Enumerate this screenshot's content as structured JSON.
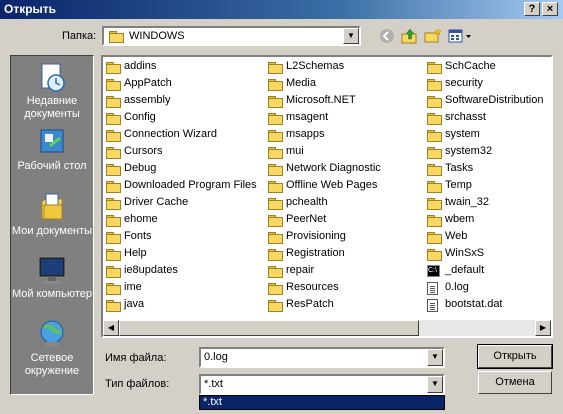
{
  "window": {
    "title": "Открыть",
    "help_glyph": "?",
    "close_glyph": "×"
  },
  "toolbar": {
    "folder_label": "Папка:",
    "current_folder": "WINDOWS",
    "icons": [
      "back-icon",
      "up-folder-icon",
      "new-folder-icon",
      "views-menu-icon"
    ]
  },
  "places": [
    {
      "label": "Недавние документы",
      "icon": "recent-documents-icon"
    },
    {
      "label": "Рабочий стол",
      "icon": "desktop-icon"
    },
    {
      "label": "Мои документы",
      "icon": "my-documents-icon"
    },
    {
      "label": "Мой компьютер",
      "icon": "my-computer-icon"
    },
    {
      "label": "Сетевое окружение",
      "icon": "network-places-icon"
    }
  ],
  "files": [
    {
      "name": "addins",
      "type": "folder"
    },
    {
      "name": "AppPatch",
      "type": "folder"
    },
    {
      "name": "assembly",
      "type": "folder"
    },
    {
      "name": "Config",
      "type": "folder"
    },
    {
      "name": "Connection Wizard",
      "type": "folder"
    },
    {
      "name": "Cursors",
      "type": "folder"
    },
    {
      "name": "Debug",
      "type": "folder"
    },
    {
      "name": "Downloaded Program Files",
      "type": "special-folder"
    },
    {
      "name": "Driver Cache",
      "type": "folder"
    },
    {
      "name": "ehome",
      "type": "folder"
    },
    {
      "name": "Fonts",
      "type": "folder"
    },
    {
      "name": "Help",
      "type": "folder"
    },
    {
      "name": "ie8updates",
      "type": "folder"
    },
    {
      "name": "ime",
      "type": "folder"
    },
    {
      "name": "java",
      "type": "folder"
    },
    {
      "name": "L2Schemas",
      "type": "folder"
    },
    {
      "name": "Media",
      "type": "folder"
    },
    {
      "name": "Microsoft.NET",
      "type": "folder"
    },
    {
      "name": "msagent",
      "type": "folder"
    },
    {
      "name": "msapps",
      "type": "folder"
    },
    {
      "name": "mui",
      "type": "folder"
    },
    {
      "name": "Network Diagnostic",
      "type": "folder"
    },
    {
      "name": "Offline Web Pages",
      "type": "special-folder"
    },
    {
      "name": "pchealth",
      "type": "folder"
    },
    {
      "name": "PeerNet",
      "type": "folder"
    },
    {
      "name": "Provisioning",
      "type": "folder"
    },
    {
      "name": "Registration",
      "type": "folder"
    },
    {
      "name": "repair",
      "type": "folder"
    },
    {
      "name": "Resources",
      "type": "folder"
    },
    {
      "name": "ResPatch",
      "type": "folder"
    },
    {
      "name": "SchCache",
      "type": "folder"
    },
    {
      "name": "security",
      "type": "folder"
    },
    {
      "name": "SoftwareDistribution",
      "type": "folder"
    },
    {
      "name": "srchasst",
      "type": "folder"
    },
    {
      "name": "system",
      "type": "folder"
    },
    {
      "name": "system32",
      "type": "folder"
    },
    {
      "name": "Tasks",
      "type": "special-folder"
    },
    {
      "name": "Temp",
      "type": "folder"
    },
    {
      "name": "twain_32",
      "type": "folder"
    },
    {
      "name": "wbem",
      "type": "folder"
    },
    {
      "name": "Web",
      "type": "folder"
    },
    {
      "name": "WinSxS",
      "type": "folder"
    },
    {
      "name": "_default",
      "type": "shortcut"
    },
    {
      "name": "0.log",
      "type": "text-file"
    },
    {
      "name": "bootstat.dat",
      "type": "text-file"
    }
  ],
  "filename": {
    "label": "Имя файла:",
    "value": "0.log"
  },
  "filetype": {
    "label": "Тип файлов:",
    "value": "*.txt",
    "options": [
      "*.txt"
    ]
  },
  "buttons": {
    "open": "Открыть",
    "cancel": "Отмена"
  }
}
